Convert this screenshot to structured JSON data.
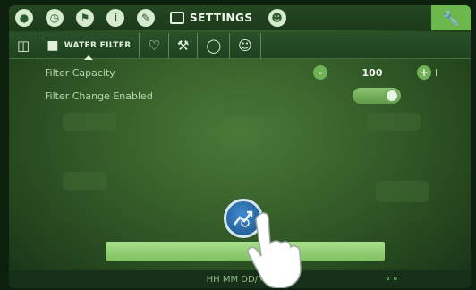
{
  "topbar": {
    "nav_icons": [
      "droplet-icon",
      "clock-icon",
      "flag-icon",
      "info-icon",
      "pencil-icon"
    ],
    "settings_label": "SETTINGS"
  },
  "subtabs": {
    "active_label": "WATER FILTER"
  },
  "settings": {
    "filter_capacity_label": "Filter Capacity",
    "filter_capacity_value": "100",
    "filter_capacity_unit": "l",
    "filter_change_label": "Filter Change Enabled",
    "filter_change_enabled": true
  },
  "footer": {
    "clock_text": "HH MM DD/MM"
  },
  "colors": {
    "accent": "#6cb84c",
    "screen_bg": "#365f2a",
    "primary_bar": "#a9e08a"
  }
}
